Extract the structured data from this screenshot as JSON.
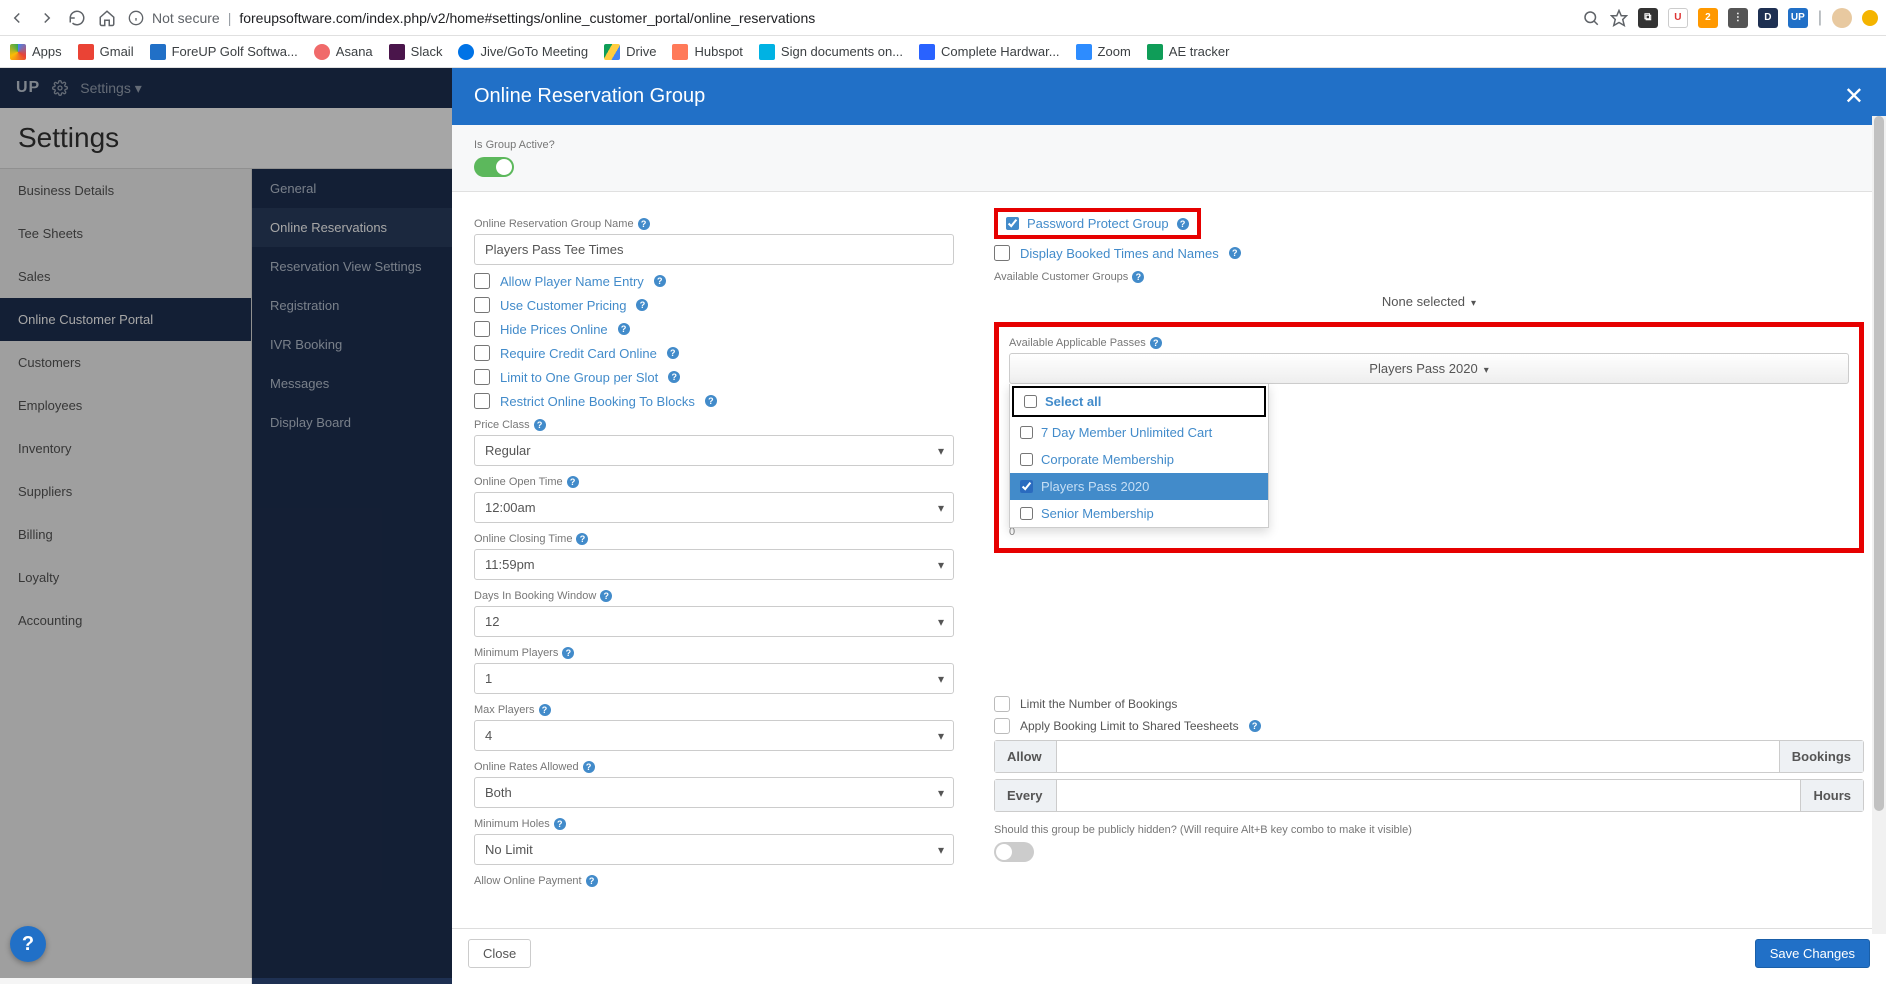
{
  "browser": {
    "not_secure": "Not secure",
    "url": "foreupsoftware.com/index.php/v2/home#settings/online_customer_portal/online_reservations",
    "bookmarks": [
      "Apps",
      "Gmail",
      "ForeUP Golf Softwa...",
      "Asana",
      "Slack",
      "Jive/GoTo Meeting",
      "Drive",
      "Hubspot",
      "Sign documents on...",
      "Complete Hardwar...",
      "Zoom",
      "AE tracker"
    ]
  },
  "top": {
    "settings": "Settings ▾"
  },
  "page_title": "Settings",
  "left_nav": [
    "Business Details",
    "Tee Sheets",
    "Sales",
    "Online Customer Portal",
    "Customers",
    "Employees",
    "Inventory",
    "Suppliers",
    "Billing",
    "Loyalty",
    "Accounting"
  ],
  "left_nav_active_index": 3,
  "sub_nav": [
    "General",
    "Online Reservations",
    "Reservation View Settings",
    "Registration",
    "IVR Booking",
    "Messages",
    "Display Board"
  ],
  "sub_nav_active_index": 1,
  "modal": {
    "title": "Online Reservation Group",
    "is_active_label": "Is Group Active?",
    "group_name_label": "Online Reservation Group Name",
    "group_name_value": "Players Pass Tee Times",
    "check_options": [
      "Allow Player Name Entry",
      "Use Customer Pricing",
      "Hide Prices Online",
      "Require Credit Card Online",
      "Limit to One Group per Slot",
      "Restrict Online Booking To Blocks"
    ],
    "price_class_label": "Price Class",
    "price_class_value": "Regular",
    "online_open_label": "Online Open Time",
    "online_open_value": "12:00am",
    "online_closing_label": "Online Closing Time",
    "online_closing_value": "11:59pm",
    "days_booking_label": "Days In Booking Window",
    "days_booking_value": "12",
    "min_players_label": "Minimum Players",
    "min_players_value": "1",
    "max_players_label": "Max Players",
    "max_players_value": "4",
    "online_rates_label": "Online Rates Allowed",
    "online_rates_value": "Both",
    "min_holes_label": "Minimum Holes",
    "min_holes_value": "No Limit",
    "allow_online_payment_label": "Allow Online Payment",
    "pwd_protect_label": "Password Protect Group",
    "display_booked_label": "Display Booked Times and Names",
    "avail_groups_label": "Available Customer Groups",
    "avail_groups_button": "None selected",
    "avail_passes_label": "Available Applicable Passes",
    "avail_passes_button": "Players Pass 2020",
    "pass_options": {
      "select_all": "Select all",
      "items": [
        "7 Day Member Unlimited Cart",
        "Corporate Membership",
        "Players Pass 2020",
        "Senior Membership"
      ],
      "selected_index": 2
    },
    "zero": "0",
    "limit_bookings": "Limit the Number of Bookings",
    "apply_limit": "Apply Booking Limit to Shared Teesheets",
    "allow": "Allow",
    "bookings": "Bookings",
    "every": "Every",
    "hours": "Hours",
    "hidden_hint": "Should this group be publicly hidden? (Will require Alt+B key combo to make it visible)",
    "close": "Close",
    "save": "Save Changes"
  }
}
